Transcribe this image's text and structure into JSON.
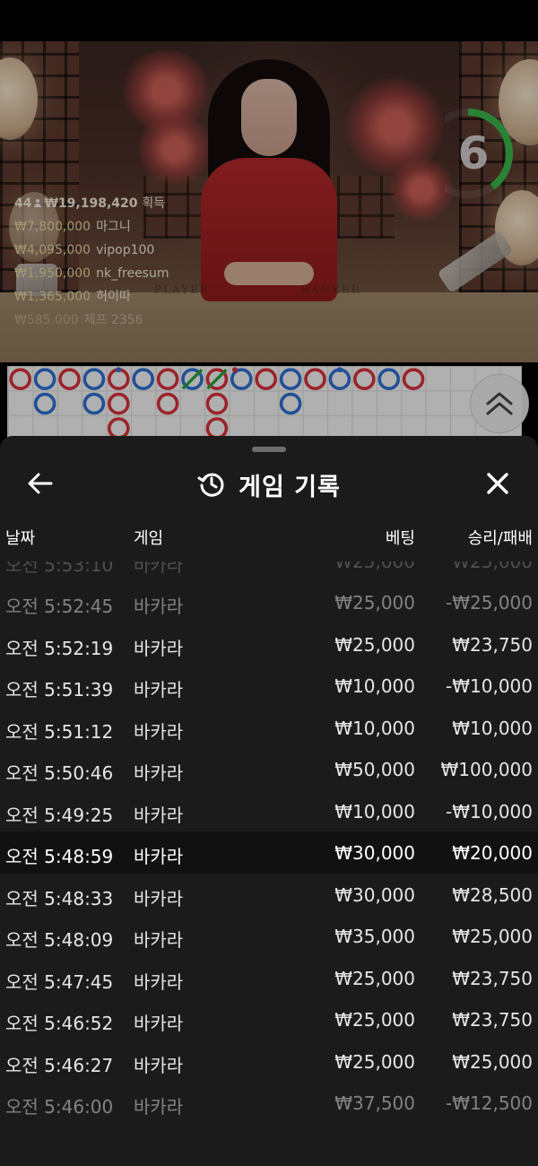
{
  "video": {
    "player_label": "PLAYER",
    "banker_label": "BANKER",
    "timer": "6",
    "timer_fraction": 0.4,
    "winners_summary": {
      "count": "44",
      "total": "₩19,198,420",
      "label": "획득"
    },
    "winners": [
      {
        "amount": "₩7,800,000",
        "name": "마그니"
      },
      {
        "amount": "₩4,095,000",
        "name": "vipop100"
      },
      {
        "amount": "₩1,950,000",
        "name": "nk_freesum"
      },
      {
        "amount": "₩1,365,000",
        "name": "허이따"
      },
      {
        "amount": "₩585,000",
        "name": "제프 2356"
      }
    ]
  },
  "road": {
    "colors": {
      "banker": "#d9313b",
      "player": "#2f6fd0",
      "tie": "#27a03c"
    },
    "cells": [
      {
        "col": 0,
        "row": 0,
        "type": "banker"
      },
      {
        "col": 1,
        "row": 0,
        "type": "player"
      },
      {
        "col": 1,
        "row": 1,
        "type": "player"
      },
      {
        "col": 2,
        "row": 0,
        "type": "banker"
      },
      {
        "col": 3,
        "row": 0,
        "type": "player"
      },
      {
        "col": 3,
        "row": 1,
        "type": "player"
      },
      {
        "col": 4,
        "row": 0,
        "type": "banker",
        "pair": "player"
      },
      {
        "col": 4,
        "row": 1,
        "type": "banker"
      },
      {
        "col": 4,
        "row": 2,
        "type": "banker"
      },
      {
        "col": 5,
        "row": 0,
        "type": "player"
      },
      {
        "col": 6,
        "row": 0,
        "type": "banker"
      },
      {
        "col": 6,
        "row": 1,
        "type": "banker"
      },
      {
        "col": 7,
        "row": 0,
        "type": "player",
        "tie": true
      },
      {
        "col": 8,
        "row": 0,
        "type": "banker",
        "tie": true
      },
      {
        "col": 8,
        "row": 1,
        "type": "banker"
      },
      {
        "col": 8,
        "row": 2,
        "type": "banker"
      },
      {
        "col": 9,
        "row": 0,
        "type": "player",
        "pair": "banker"
      },
      {
        "col": 10,
        "row": 0,
        "type": "banker"
      },
      {
        "col": 11,
        "row": 0,
        "type": "player"
      },
      {
        "col": 11,
        "row": 1,
        "type": "player"
      },
      {
        "col": 12,
        "row": 0,
        "type": "banker"
      },
      {
        "col": 13,
        "row": 0,
        "type": "player",
        "pair": "player"
      },
      {
        "col": 14,
        "row": 0,
        "type": "banker"
      },
      {
        "col": 15,
        "row": 0,
        "type": "player"
      },
      {
        "col": 16,
        "row": 0,
        "type": "banker"
      }
    ]
  },
  "history": {
    "title": "게임 기록",
    "columns": {
      "date": "날짜",
      "game": "게임",
      "bet": "베팅",
      "result": "승리/패배"
    },
    "partial_row": {
      "date": "오전 5:53:10",
      "game": "바카라",
      "bet": "₩25,000",
      "result": "₩25,000"
    },
    "rows": [
      {
        "date": "오전 5:52:45",
        "game": "바카라",
        "bet": "₩25,000",
        "result": "-₩25,000"
      },
      {
        "date": "오전 5:52:19",
        "game": "바카라",
        "bet": "₩25,000",
        "result": "₩23,750"
      },
      {
        "date": "오전 5:51:39",
        "game": "바카라",
        "bet": "₩10,000",
        "result": "-₩10,000"
      },
      {
        "date": "오전 5:51:12",
        "game": "바카라",
        "bet": "₩10,000",
        "result": "₩10,000"
      },
      {
        "date": "오전 5:50:46",
        "game": "바카라",
        "bet": "₩50,000",
        "result": "₩100,000"
      },
      {
        "date": "오전 5:49:25",
        "game": "바카라",
        "bet": "₩10,000",
        "result": "-₩10,000"
      },
      {
        "date": "오전 5:48:59",
        "game": "바카라",
        "bet": "₩30,000",
        "result": "₩20,000"
      },
      {
        "date": "오전 5:48:33",
        "game": "바카라",
        "bet": "₩30,000",
        "result": "₩28,500"
      },
      {
        "date": "오전 5:48:09",
        "game": "바카라",
        "bet": "₩35,000",
        "result": "₩25,000"
      },
      {
        "date": "오전 5:47:45",
        "game": "바카라",
        "bet": "₩25,000",
        "result": "₩23,750"
      },
      {
        "date": "오전 5:46:52",
        "game": "바카라",
        "bet": "₩25,000",
        "result": "₩23,750"
      },
      {
        "date": "오전 5:46:27",
        "game": "바카라",
        "bet": "₩25,000",
        "result": "₩25,000"
      },
      {
        "date": "오전 5:46:00",
        "game": "바카라",
        "bet": "₩37,500",
        "result": "-₩12,500"
      }
    ]
  },
  "icons": {
    "back": "arrow-left-icon",
    "close": "close-icon",
    "history": "history-clock-icon",
    "collapse": "chevron-double-up-icon",
    "players": "user-icon"
  }
}
